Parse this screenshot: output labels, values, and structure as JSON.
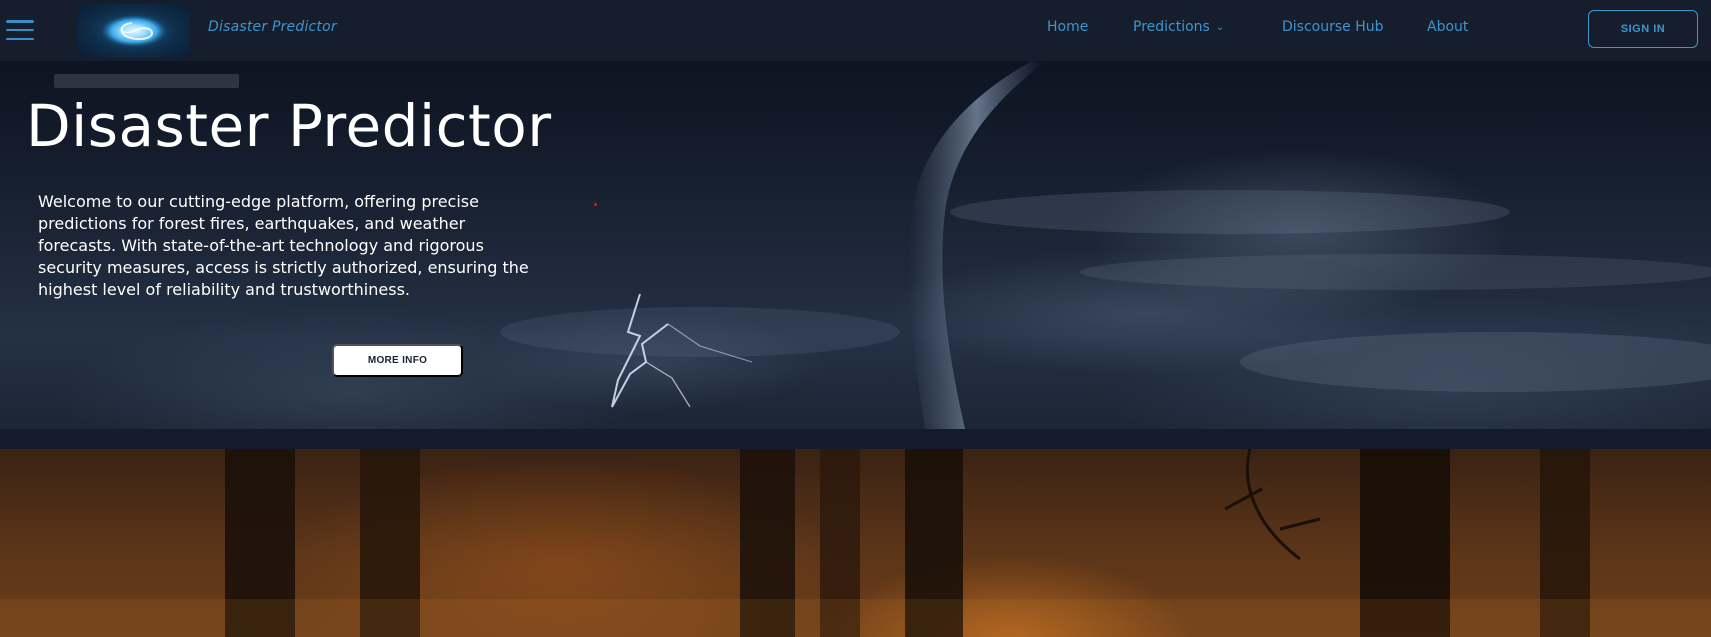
{
  "navbar": {
    "brand": "Disaster Predictor",
    "links": {
      "home": "Home",
      "predictions": "Predictions",
      "discourse": "Discourse Hub",
      "about": "About"
    },
    "signin_label": "SIGN IN"
  },
  "hero": {
    "title": "Disaster Predictor",
    "description": "Welcome to our cutting-edge platform, offering precise predictions for forest fires, earthquakes, and weather forecasts. With state-of-the-art technology and rigorous security measures, access is strictly authorized, ensuring the highest level of reliability and trustworthiness.",
    "button_label": "MORE INFO"
  },
  "colors": {
    "nav_bg": "#161d2c",
    "accent": "#3f95d0",
    "hero_text": "#ffffff",
    "button_bg": "#ffffff"
  },
  "icons": {
    "menu": "hamburger-menu-icon",
    "logo": "storm-swirl-logo",
    "dropdown": "chevron-down-icon"
  }
}
